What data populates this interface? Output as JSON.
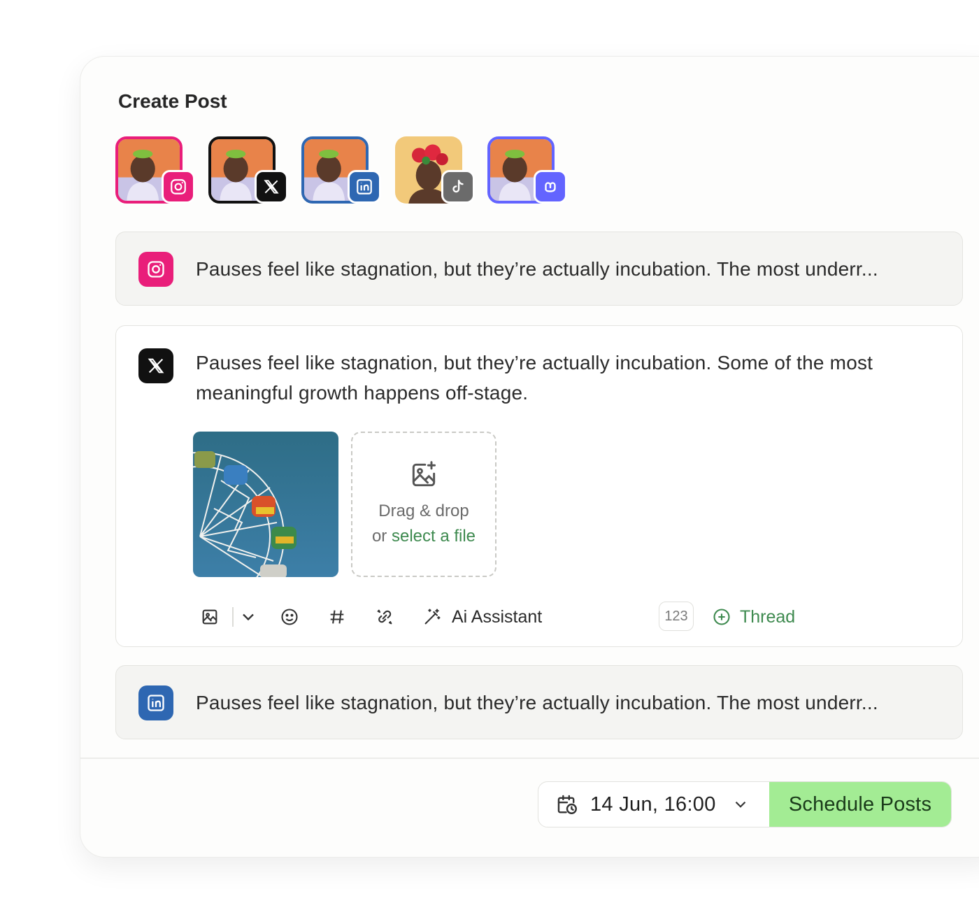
{
  "header": {
    "title": "Create Post"
  },
  "accounts": [
    {
      "network": "instagram",
      "icon": "instagram-icon",
      "color": "#e91e7a"
    },
    {
      "network": "x",
      "icon": "x-logo-icon",
      "color": "#111111"
    },
    {
      "network": "linkedin",
      "icon": "linkedin-icon",
      "color": "#2e67b2"
    },
    {
      "network": "tiktok",
      "icon": "tiktok-icon",
      "color": "#6b6b6b"
    },
    {
      "network": "mastodon",
      "icon": "mastodon-icon",
      "color": "#6364ff"
    }
  ],
  "posts": {
    "instagram": {
      "text": "Pauses feel like stagnation, but they’re actually incubation. The most underr..."
    },
    "x": {
      "text": "Pauses feel like stagnation, but they’re actually incubation. Some of the most meaningful growth happens off-stage."
    },
    "linkedin": {
      "text": "Pauses feel like stagnation, but they’re actually incubation. The most underr..."
    }
  },
  "dropzone": {
    "line1": "Drag & drop",
    "line2_prefix": "or ",
    "line2_link": "select a file"
  },
  "toolbar": {
    "ai_assistant_label": "Ai Assistant",
    "char_counter": "123",
    "thread_label": "Thread"
  },
  "footer": {
    "schedule_date": "14 Jun, 16:00",
    "schedule_button": "Schedule Posts"
  },
  "colors": {
    "accent_green": "#a3ec94",
    "link_green": "#3e8a4f",
    "instagram": "#e91e7a",
    "x": "#111111",
    "linkedin": "#2e67b2",
    "tiktok": "#6b6b6b",
    "mastodon": "#6364ff"
  }
}
